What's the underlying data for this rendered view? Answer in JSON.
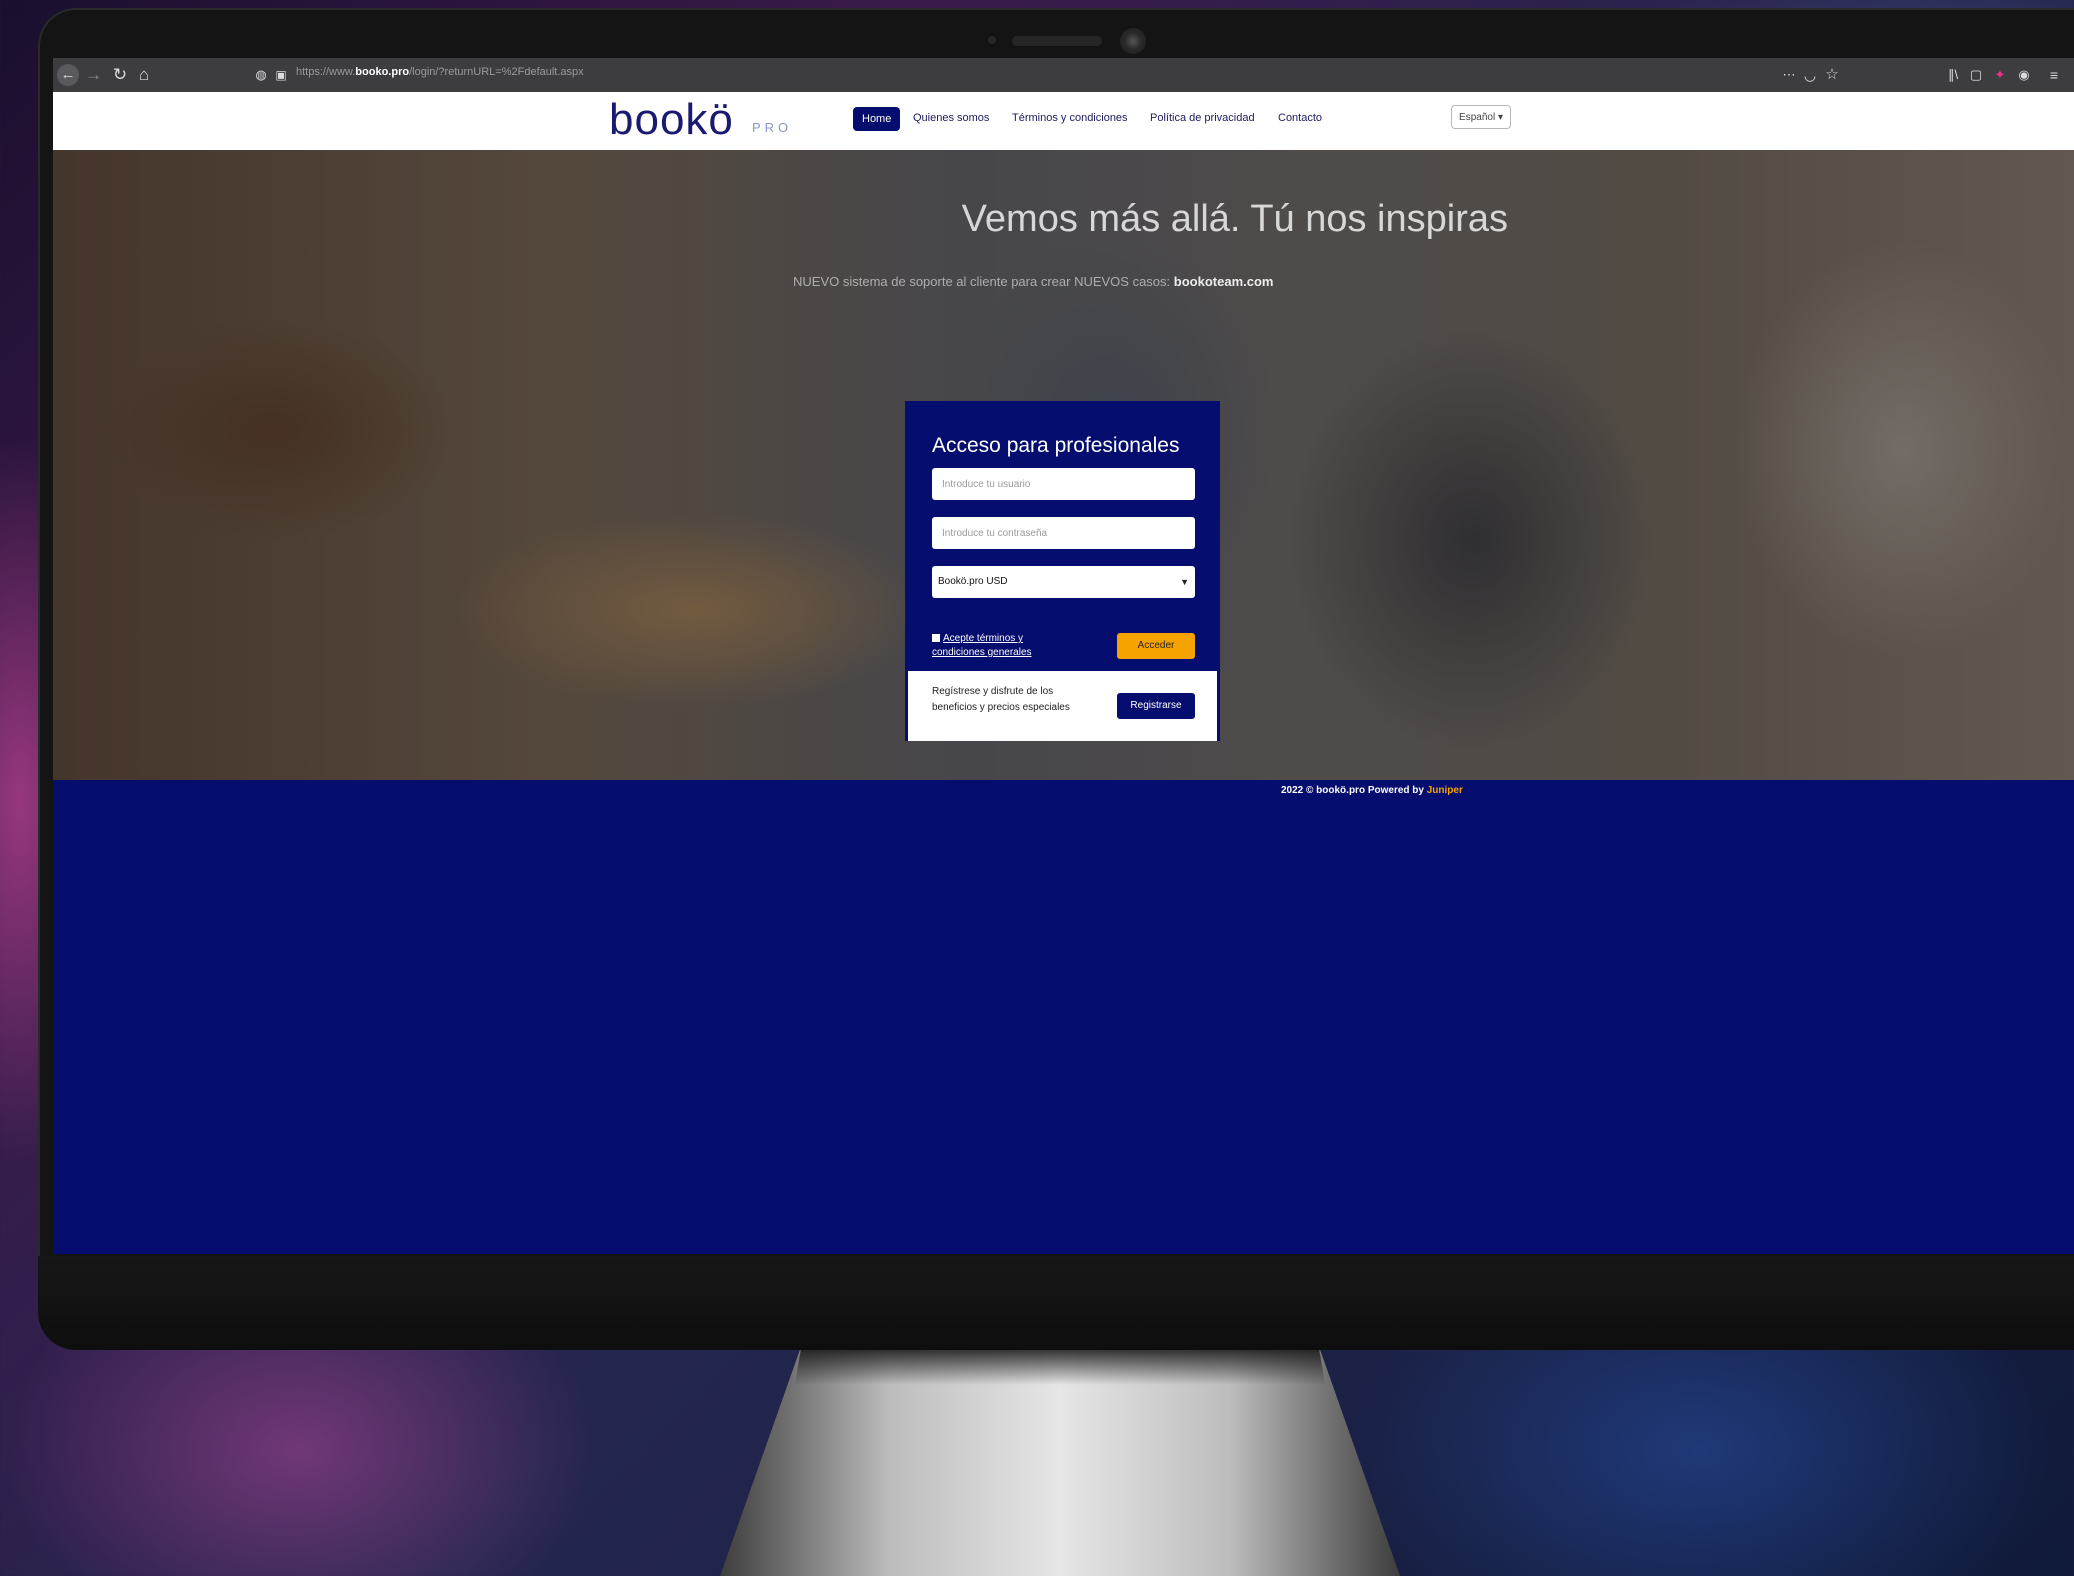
{
  "browser": {
    "url_prefix": "https://www.",
    "url_domain": "booko.pro",
    "url_path": "/login/?returnURL=%2Fdefault.aspx"
  },
  "nav": {
    "logo": "bookö",
    "logo_suffix": "PRO",
    "links": [
      "Home",
      "Quienes somos",
      "Términos y condiciones",
      "Política de privacidad",
      "Contacto"
    ],
    "language": "Español ▾"
  },
  "hero": {
    "title": "Vemos más allá. Tú nos inspiras",
    "subtitle": "NUEVO sistema de soporte al cliente para crear NUEVOS casos:",
    "subtitle_link": "bookoteam.com"
  },
  "login": {
    "title": "Acceso para profesionales",
    "username_placeholder": "Introduce tu usuario",
    "password_placeholder": "Introduce tu contraseña",
    "site_select": "Bookö.pro USD",
    "terms_label": "Acepte términos y condiciones generales",
    "submit_label": "Acceder",
    "register_text": "Regístrese y disfrute de los beneficios y precios especiales",
    "register_label": "Registrarse"
  },
  "footer": {
    "copyright": "2022 © bookö.pro Powered by",
    "powered_by": "Juniper"
  },
  "colors": {
    "brand_navy": "#050d6e",
    "accent_orange": "#f6a300"
  }
}
